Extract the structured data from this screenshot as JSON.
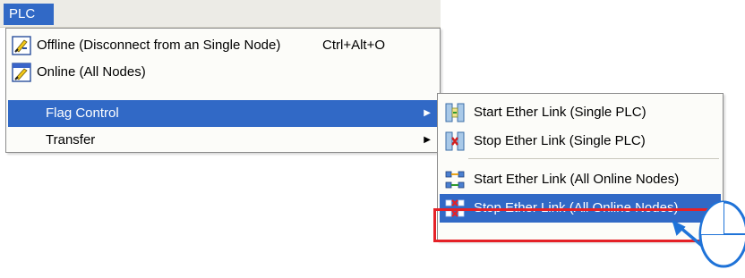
{
  "menubar": {
    "menu": "PLC"
  },
  "plc_menu": {
    "items": [
      {
        "label": "Offline (Disconnect from an Single Node)",
        "shortcut": "Ctrl+Alt+O",
        "icon": "offline-plc-icon"
      },
      {
        "label": "Online (All Nodes)",
        "icon": "online-plc-icon"
      },
      {
        "label": "Flag Control",
        "submenu": true,
        "highlighted": true
      },
      {
        "label": "Transfer",
        "submenu": true
      }
    ]
  },
  "flag_control_submenu": {
    "items": [
      {
        "label": "Start Ether Link (Single PLC)",
        "icon": "start-ether-link-single-icon"
      },
      {
        "label": "Stop Ether Link (Single PLC)",
        "icon": "stop-ether-link-single-icon"
      },
      {
        "label": "Start Ether Link (All Online Nodes)",
        "icon": "start-ether-link-all-icon"
      },
      {
        "label": "Stop Ether Link (All Online Nodes)",
        "icon": "stop-ether-link-all-icon",
        "highlighted": true
      }
    ]
  },
  "colors": {
    "highlight": "#3169c6",
    "callout_border": "#e52127",
    "pointer": "#1f73d8"
  }
}
